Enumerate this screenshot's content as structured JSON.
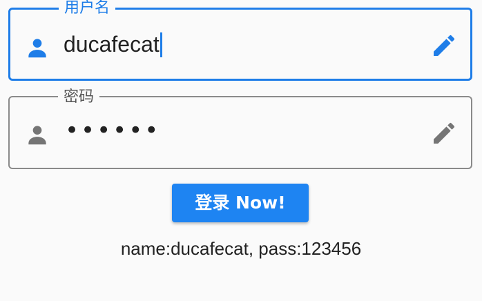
{
  "username_field": {
    "label": "用户名",
    "value": "ducafecat",
    "leading_icon": "person-icon",
    "trailing_icon": "edit-icon",
    "focused": true
  },
  "password_field": {
    "label": "密码",
    "masked_value": "••••••",
    "leading_icon": "person-icon",
    "trailing_icon": "edit-icon",
    "focused": false
  },
  "login_button": {
    "label": "登录 Now!"
  },
  "status_text": "name:ducafecat, pass:123456",
  "colors": {
    "accent": "#1e7de8",
    "button": "#1e84f2",
    "idle_border": "#8a8a8a",
    "idle_icon": "#757575",
    "background": "#fafafa"
  }
}
